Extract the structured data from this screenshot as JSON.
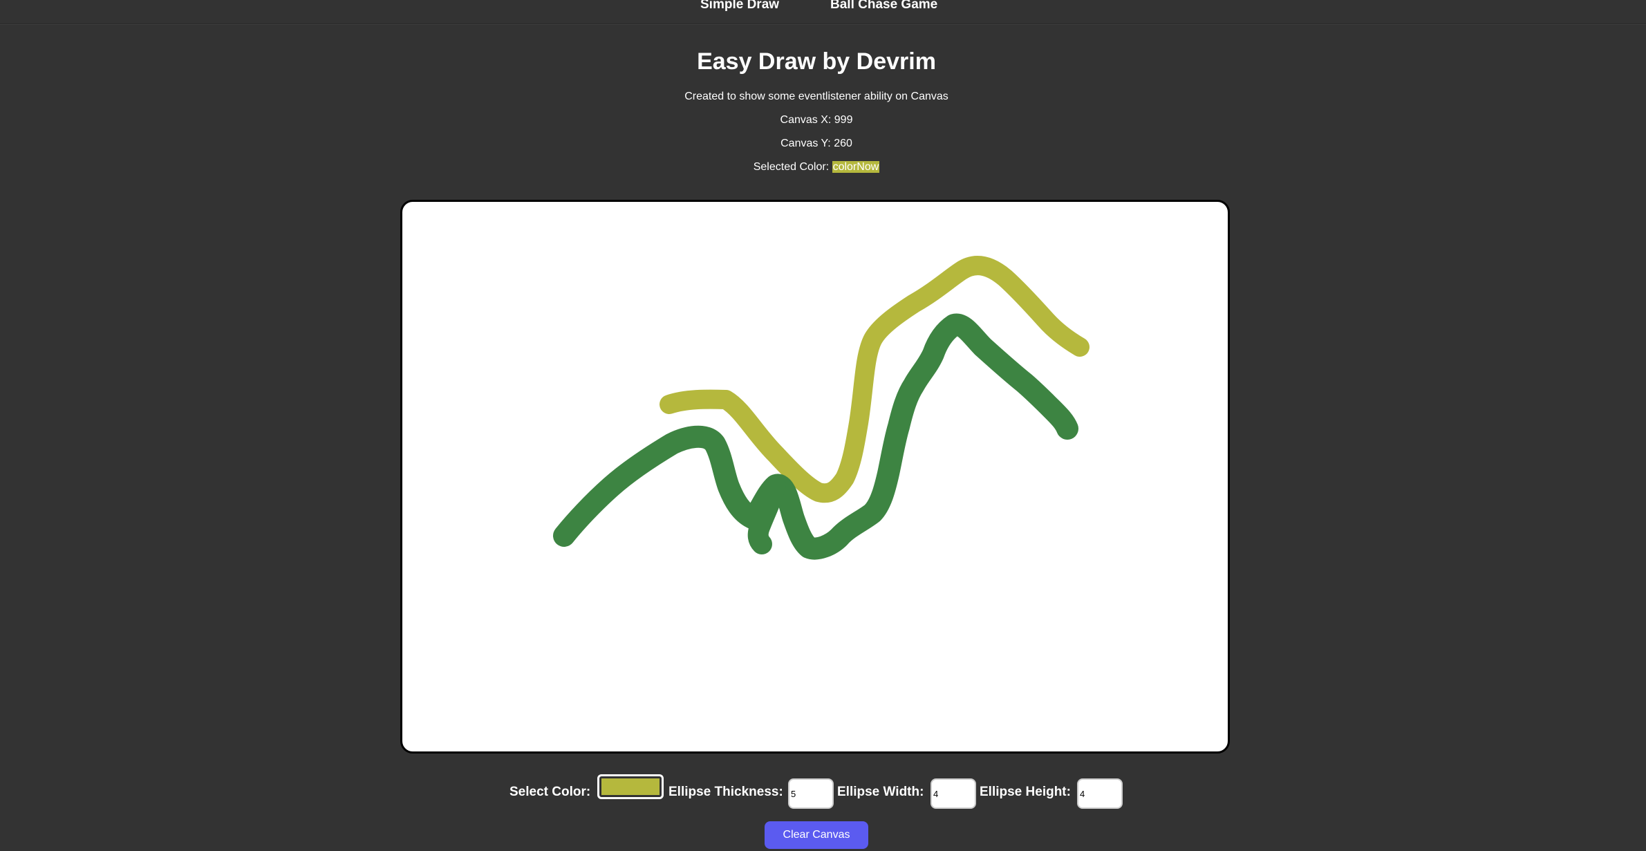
{
  "nav": {
    "simple_draw": "Simple Draw",
    "ball_chase": "Ball Chase Game"
  },
  "header": {
    "title": "Easy Draw by Devrim",
    "description": "Created to show some eventlistener ability on Canvas",
    "canvas_x": "Canvas X: 999",
    "canvas_y": "Canvas Y: 260",
    "selected_color_label": "Selected Color:",
    "selected_color_value": "colorNow"
  },
  "colors": {
    "background": "#333333",
    "selected": "#b5b83d",
    "stroke_green": "#3d8442",
    "button": "#5b5bf0"
  },
  "controls": {
    "select_color_label": "Select Color:",
    "ellipse_thickness_label": "Ellipse Thickness:",
    "ellipse_thickness_value": "5",
    "ellipse_width_label": "Ellipse Width:",
    "ellipse_width_value": "4",
    "ellipse_height_label": "Ellipse Height:",
    "ellipse_height_value": "4",
    "clear_button": "Clear Canvas"
  }
}
